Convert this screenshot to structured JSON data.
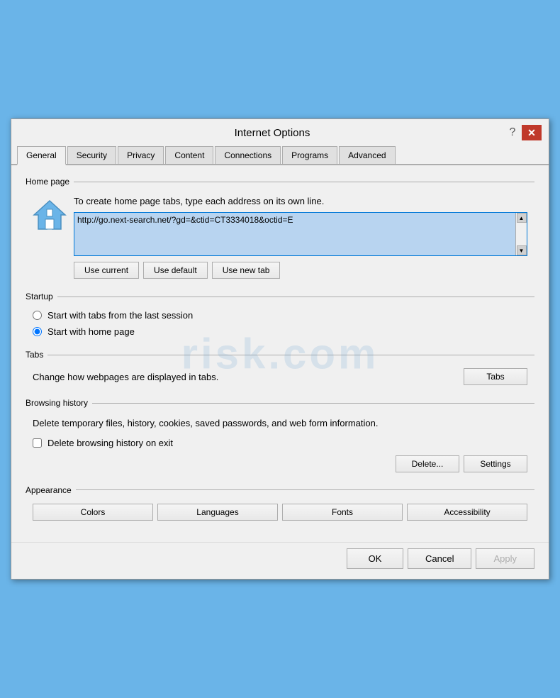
{
  "titleBar": {
    "title": "Internet Options",
    "helpLabel": "?",
    "closeLabel": "✕"
  },
  "tabs": {
    "items": [
      {
        "label": "General",
        "active": true
      },
      {
        "label": "Security",
        "active": false
      },
      {
        "label": "Privacy",
        "active": false
      },
      {
        "label": "Content",
        "active": false
      },
      {
        "label": "Connections",
        "active": false
      },
      {
        "label": "Programs",
        "active": false
      },
      {
        "label": "Advanced",
        "active": false
      }
    ]
  },
  "homePage": {
    "sectionTitle": "Home page",
    "description": "To create home page tabs, type each address on its own line.",
    "urlValue": "http://go.next-search.net/?gd=&ctid=CT3334018&octid=E",
    "btnUseCurrent": "Use current",
    "btnUseDefault": "Use default",
    "btnUseNewTab": "Use new tab"
  },
  "startup": {
    "sectionTitle": "Startup",
    "option1": "Start with tabs from the last session",
    "option2": "Start with home page",
    "selectedOption": "option2"
  },
  "tabs_section": {
    "sectionTitle": "Tabs",
    "description": "Change how webpages are displayed in tabs.",
    "btnLabel": "Tabs"
  },
  "browsingHistory": {
    "sectionTitle": "Browsing history",
    "description": "Delete temporary files, history, cookies, saved passwords, and web form information.",
    "checkboxLabel": "Delete browsing history on exit",
    "checkboxChecked": false,
    "btnDelete": "Delete...",
    "btnSettings": "Settings"
  },
  "appearance": {
    "sectionTitle": "Appearance",
    "btnColors": "Colors",
    "btnLanguages": "Languages",
    "btnFonts": "Fonts",
    "btnAccessibility": "Accessibility"
  },
  "footer": {
    "btnOK": "OK",
    "btnCancel": "Cancel",
    "btnApply": "Apply"
  },
  "watermark": "risk.com"
}
